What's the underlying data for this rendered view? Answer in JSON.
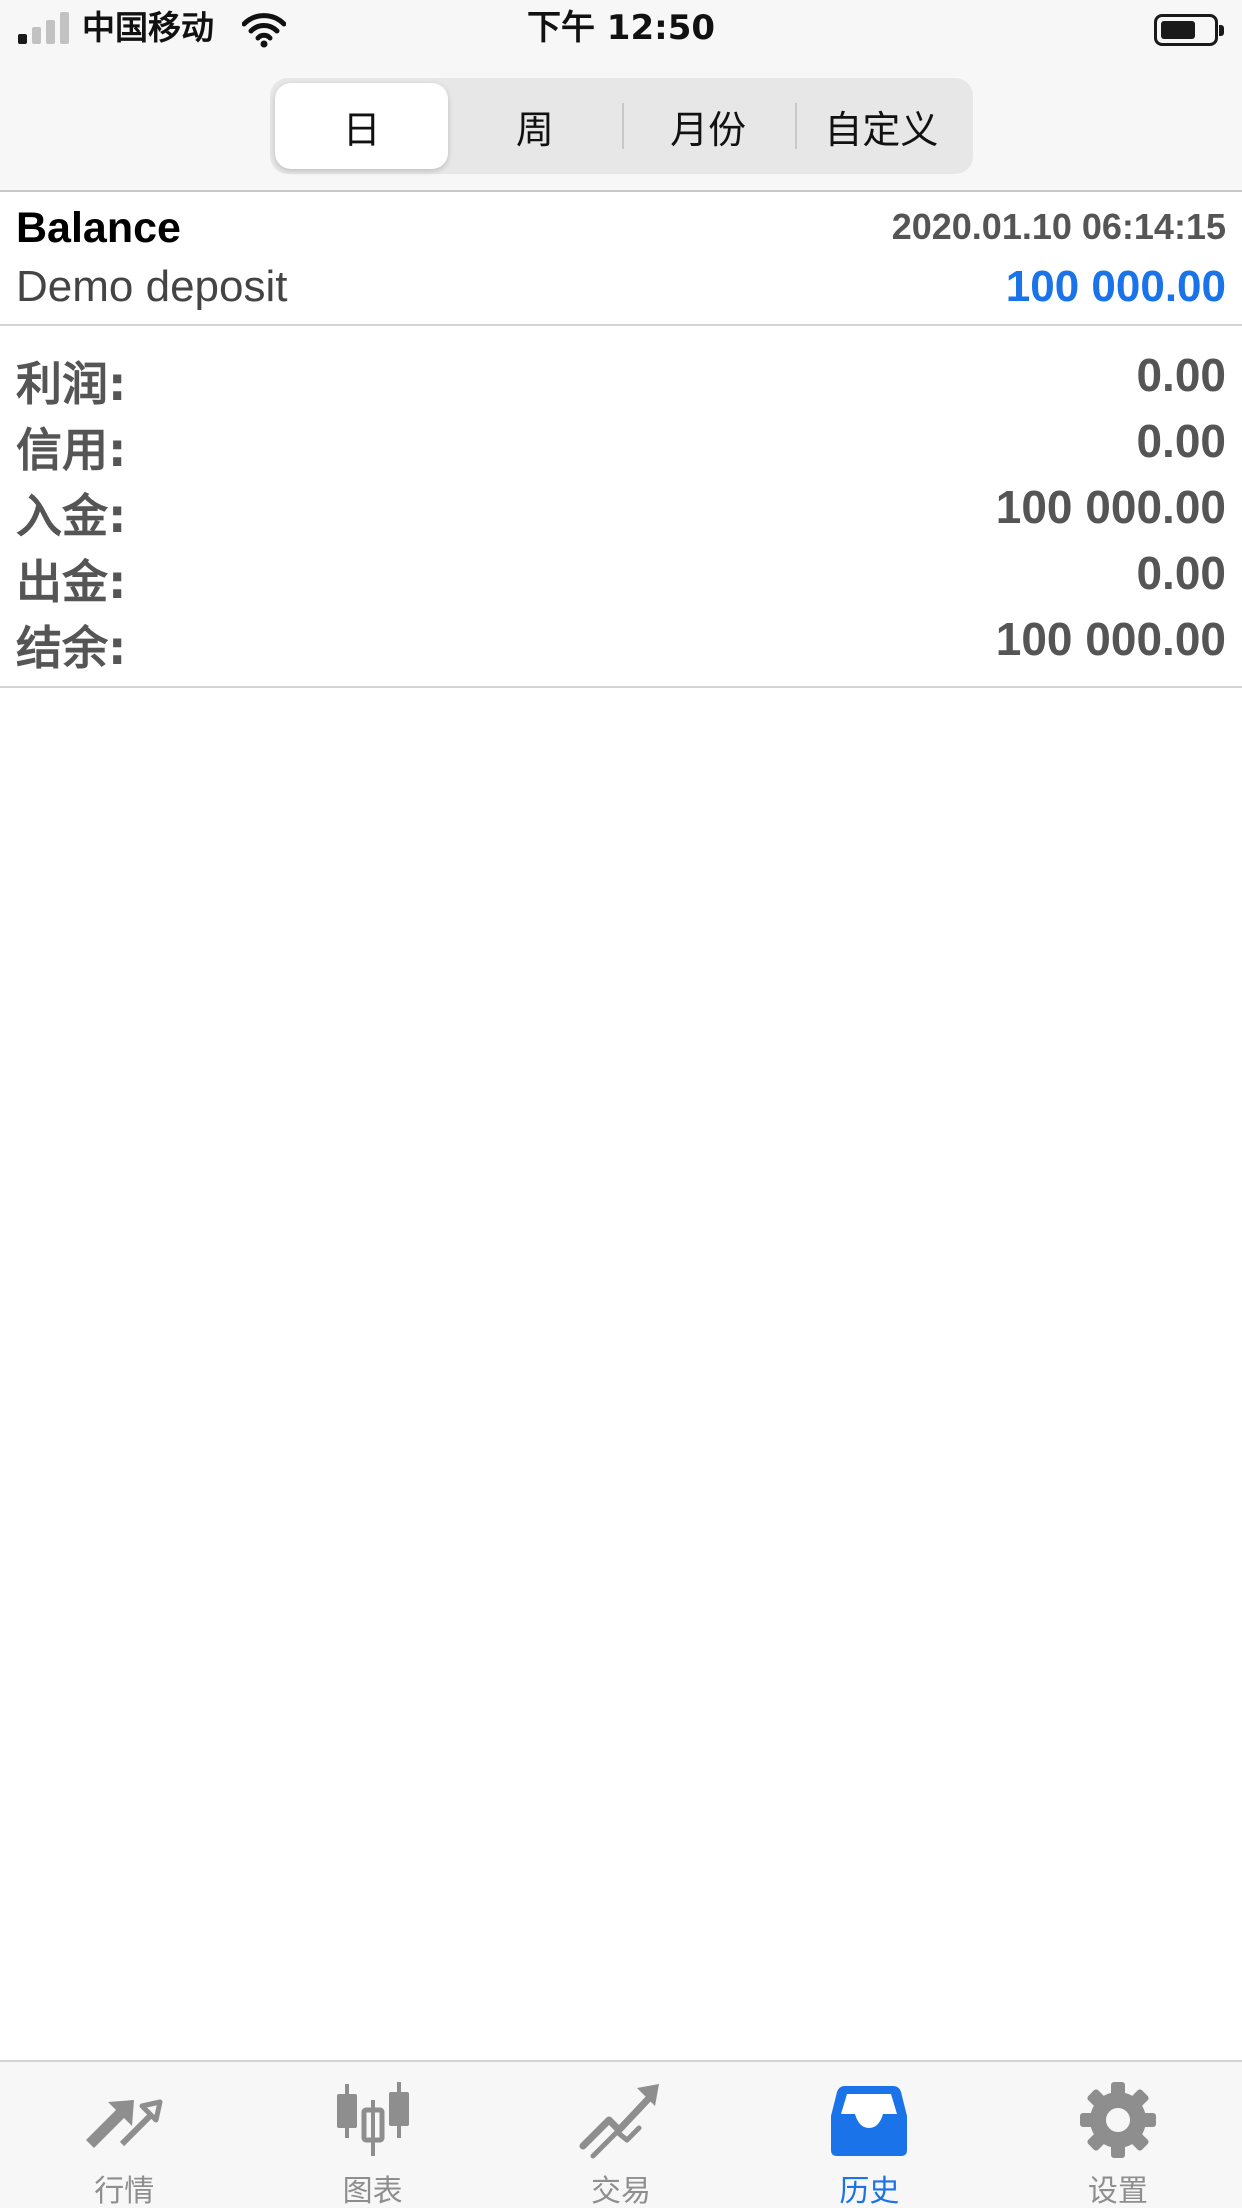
{
  "status_bar": {
    "carrier": "中国移动",
    "time": "下午 12:50",
    "signal_bars_active": 1,
    "battery_level": 0.6
  },
  "period_tabs": [
    {
      "label": "日",
      "selected": true
    },
    {
      "label": "周",
      "selected": false
    },
    {
      "label": "月份",
      "selected": false
    },
    {
      "label": "自定义",
      "selected": false
    }
  ],
  "deal": {
    "type": "Balance",
    "datetime": "2020.01.10 06:14:15",
    "comment": "Demo deposit",
    "amount": "100 000.00"
  },
  "summary": [
    {
      "label": "利润:",
      "value": "0.00"
    },
    {
      "label": "信用:",
      "value": "0.00"
    },
    {
      "label": "入金:",
      "value": "100 000.00"
    },
    {
      "label": "出金:",
      "value": "0.00"
    },
    {
      "label": "结余:",
      "value": "100 000.00"
    }
  ],
  "tab_bar": [
    {
      "label": "行情",
      "icon": "quotes-arrows-icon",
      "active": false
    },
    {
      "label": "图表",
      "icon": "candlestick-chart-icon",
      "active": false
    },
    {
      "label": "交易",
      "icon": "trade-trend-icon",
      "active": false
    },
    {
      "label": "历史",
      "icon": "history-inbox-icon",
      "active": true
    },
    {
      "label": "设置",
      "icon": "gear-icon",
      "active": false
    }
  ],
  "colors": {
    "accent": "#1a73e8",
    "inactive": "#8e8e8e",
    "muted_text": "#555555"
  }
}
